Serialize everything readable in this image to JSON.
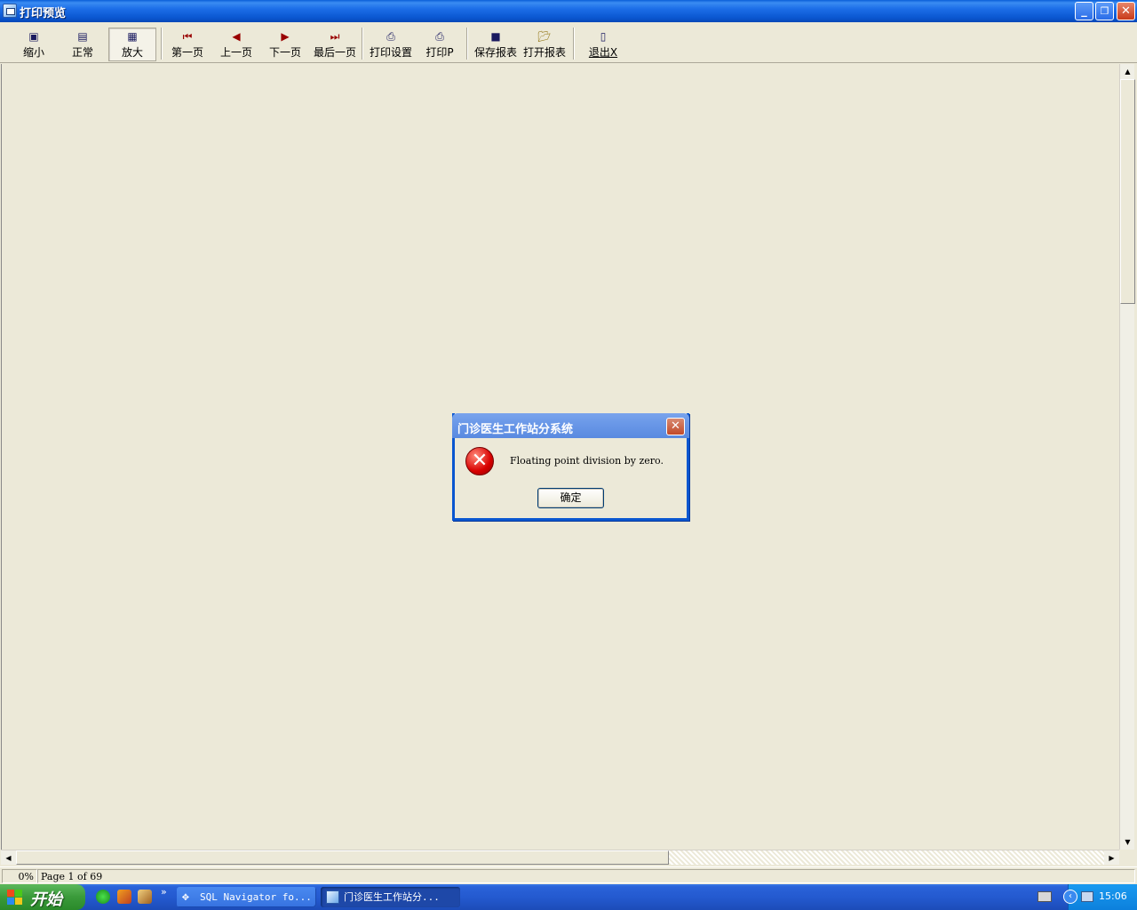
{
  "window": {
    "title": "打印预览"
  },
  "toolbar": {
    "zoom_out": "缩小",
    "normal": "正常",
    "zoom_in": "放大",
    "first_page": "第一页",
    "prev_page": "上一页",
    "next_page": "下一页",
    "last_page": "最后一页",
    "print_setup": "打印设置",
    "print": "打印P",
    "save_report": "保存报表",
    "open_report": "打开报表",
    "exit": "退出X"
  },
  "status": {
    "progress": "0%",
    "page_info": "Page 1 of 69"
  },
  "dialog": {
    "title": "门诊医生工作站分系统",
    "message": "Floating point division by zero.",
    "ok_label": "确定"
  },
  "taskbar": {
    "start_label": "开始",
    "overflow": "»",
    "items": [
      {
        "label": "SQL Navigator fo..."
      },
      {
        "label": "门诊医生工作站分..."
      }
    ],
    "clock": "15:06"
  },
  "colors": {
    "accent": "#0a56d0",
    "error": "#d80000"
  }
}
